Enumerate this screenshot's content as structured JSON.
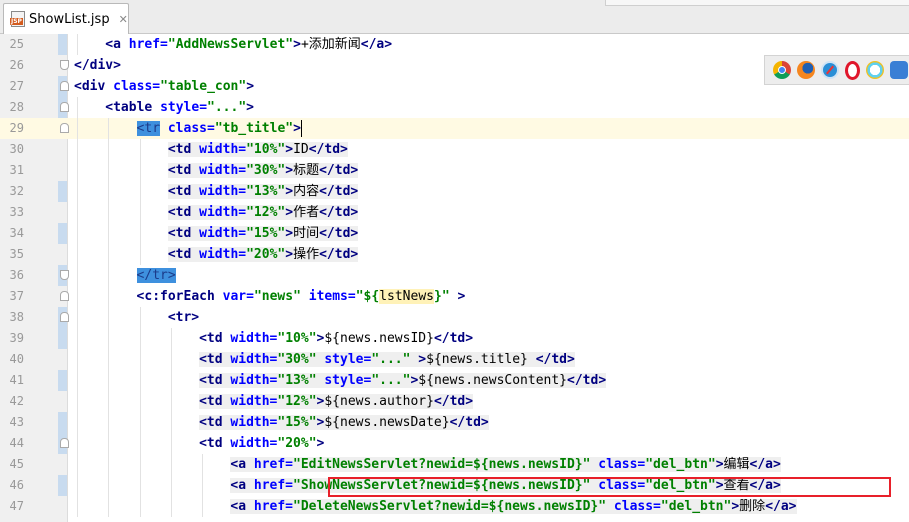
{
  "tab": {
    "title": "ShowList.jsp",
    "icon_text": "JSP"
  },
  "browser_toolbar": {
    "icons": [
      "chrome-icon",
      "firefox-icon",
      "safari-icon",
      "opera-icon",
      "ie-icon",
      "edge-icon"
    ]
  },
  "colors": {
    "tag": "#000080",
    "attribute": "#0000ff",
    "string": "#008000",
    "selection": "#3e90de",
    "caret_line": "#fffae3",
    "red_box": "#e8202a"
  },
  "editor": {
    "caret_line": "29",
    "lines": [
      {
        "num": "25",
        "tokens": [
          [
            "tag",
            "<a "
          ],
          [
            "attr",
            "href="
          ],
          [
            "str",
            "\"AddNewsServlet\""
          ],
          [
            "tag",
            ">"
          ],
          [
            "txt",
            "+添加新闻"
          ],
          [
            "tag",
            "</a>"
          ]
        ]
      },
      {
        "num": "26",
        "tokens": [
          [
            "tag",
            "</div>"
          ]
        ]
      },
      {
        "num": "27",
        "tokens": [
          [
            "tag",
            "<div "
          ],
          [
            "attr",
            "class="
          ],
          [
            "str",
            "\"table_con\""
          ],
          [
            "tag",
            ">"
          ]
        ]
      },
      {
        "num": "28",
        "tokens": [
          [
            "tag",
            "<table "
          ],
          [
            "attr",
            "style="
          ],
          [
            "str",
            "\"...\""
          ],
          [
            "tag",
            ">"
          ]
        ]
      },
      {
        "num": "29",
        "tokens": [
          [
            "sel",
            "<tr"
          ],
          [
            "tag",
            " "
          ],
          [
            "attr",
            "class="
          ],
          [
            "str",
            "\"tb_title\""
          ],
          [
            "tag",
            ">"
          ],
          [
            "cursor",
            ""
          ]
        ]
      },
      {
        "num": "30",
        "tokens": [
          [
            "tag",
            "<td "
          ],
          [
            "attr",
            "width="
          ],
          [
            "str",
            "\"10%\""
          ],
          [
            "tag",
            ">"
          ],
          [
            "txt",
            "ID"
          ],
          [
            "tag",
            "</td>"
          ]
        ]
      },
      {
        "num": "31",
        "tokens": [
          [
            "tag",
            "<td "
          ],
          [
            "attr",
            "width="
          ],
          [
            "str",
            "\"30%\""
          ],
          [
            "tag",
            ">"
          ],
          [
            "txt",
            "标题"
          ],
          [
            "tag",
            "</td>"
          ]
        ]
      },
      {
        "num": "32",
        "tokens": [
          [
            "tag",
            "<td "
          ],
          [
            "attr",
            "width="
          ],
          [
            "str",
            "\"13%\""
          ],
          [
            "tag",
            ">"
          ],
          [
            "txt",
            "内容"
          ],
          [
            "tag",
            "</td>"
          ]
        ]
      },
      {
        "num": "33",
        "tokens": [
          [
            "tag",
            "<td "
          ],
          [
            "attr",
            "width="
          ],
          [
            "str",
            "\"12%\""
          ],
          [
            "tag",
            ">"
          ],
          [
            "txt",
            "作者"
          ],
          [
            "tag",
            "</td>"
          ]
        ]
      },
      {
        "num": "34",
        "tokens": [
          [
            "tag",
            "<td "
          ],
          [
            "attr",
            "width="
          ],
          [
            "str",
            "\"15%\""
          ],
          [
            "tag",
            ">"
          ],
          [
            "txt",
            "时间"
          ],
          [
            "tag",
            "</td>"
          ]
        ]
      },
      {
        "num": "35",
        "tokens": [
          [
            "tag",
            "<td "
          ],
          [
            "attr",
            "width="
          ],
          [
            "str",
            "\"20%\""
          ],
          [
            "tag",
            ">"
          ],
          [
            "txt",
            "操作"
          ],
          [
            "tag",
            "</td>"
          ]
        ]
      },
      {
        "num": "36",
        "tokens": [
          [
            "sel",
            "</tr>"
          ]
        ]
      },
      {
        "num": "37",
        "tokens": [
          [
            "tag",
            "<c:forEach "
          ],
          [
            "attr",
            "var="
          ],
          [
            "str",
            "\"news\""
          ],
          [
            "tag",
            " "
          ],
          [
            "attr",
            "items="
          ],
          [
            "str",
            "\"${"
          ],
          [
            "hl",
            "lstNews"
          ],
          [
            "str",
            "}\""
          ],
          [
            "tag",
            " >"
          ]
        ]
      },
      {
        "num": "38",
        "tokens": [
          [
            "tag",
            "<tr>"
          ]
        ]
      },
      {
        "num": "39",
        "tokens": [
          [
            "tag",
            "<td "
          ],
          [
            "attr",
            "width="
          ],
          [
            "str",
            "\"10%\""
          ],
          [
            "tag",
            ">"
          ],
          [
            "el",
            "${news.newsID}"
          ],
          [
            "tag",
            "</td>"
          ]
        ]
      },
      {
        "num": "40",
        "tokens": [
          [
            "tag",
            "<td "
          ],
          [
            "attr",
            "width="
          ],
          [
            "str",
            "\"30%\""
          ],
          [
            "tag",
            " "
          ],
          [
            "attr",
            "style="
          ],
          [
            "str",
            "\"...\""
          ],
          [
            "tag",
            " >"
          ],
          [
            "el",
            "${news.title} "
          ],
          [
            "tag",
            "</td>"
          ]
        ]
      },
      {
        "num": "41",
        "tokens": [
          [
            "tag",
            "<td "
          ],
          [
            "attr",
            "width="
          ],
          [
            "str",
            "\"13%\""
          ],
          [
            "tag",
            " "
          ],
          [
            "attr",
            "style="
          ],
          [
            "str",
            "\"...\""
          ],
          [
            "tag",
            ">"
          ],
          [
            "el",
            "${news.newsContent}"
          ],
          [
            "tag",
            "</td>"
          ]
        ]
      },
      {
        "num": "42",
        "tokens": [
          [
            "tag",
            "<td "
          ],
          [
            "attr",
            "width="
          ],
          [
            "str",
            "\"12%\""
          ],
          [
            "tag",
            ">"
          ],
          [
            "el",
            "${news.author}"
          ],
          [
            "tag",
            "</td>"
          ]
        ]
      },
      {
        "num": "43",
        "tokens": [
          [
            "tag",
            "<td "
          ],
          [
            "attr",
            "width="
          ],
          [
            "str",
            "\"15%\""
          ],
          [
            "tag",
            ">"
          ],
          [
            "el",
            "${news.newsDate}"
          ],
          [
            "tag",
            "</td>"
          ]
        ]
      },
      {
        "num": "44",
        "tokens": [
          [
            "tag",
            "<td "
          ],
          [
            "attr",
            "width="
          ],
          [
            "str",
            "\"20%\""
          ],
          [
            "tag",
            ">"
          ]
        ]
      },
      {
        "num": "45",
        "tokens": [
          [
            "tag",
            "<a "
          ],
          [
            "attr",
            "href="
          ],
          [
            "str",
            "\"EditNewsServlet?newid=${news.newsID}\""
          ],
          [
            "tag",
            " "
          ],
          [
            "attr",
            "class="
          ],
          [
            "str",
            "\"del_btn\""
          ],
          [
            "tag",
            ">"
          ],
          [
            "txt",
            "编辑"
          ],
          [
            "tag",
            "</a>"
          ]
        ]
      },
      {
        "num": "46",
        "tokens": [
          [
            "tag",
            "<a "
          ],
          [
            "attr",
            "href="
          ],
          [
            "str",
            "\"ShowNewsServlet?newid=${news.newsID}\""
          ],
          [
            "tag",
            " "
          ],
          [
            "attr",
            "class="
          ],
          [
            "str",
            "\"del_btn\""
          ],
          [
            "tag",
            ">"
          ],
          [
            "txt",
            "查看"
          ],
          [
            "tag",
            "</a>"
          ]
        ]
      },
      {
        "num": "47",
        "tokens": [
          [
            "tag",
            "<a "
          ],
          [
            "attr",
            "href="
          ],
          [
            "str",
            "\"DeleteNewsServlet?newid=${news.newsID}\""
          ],
          [
            "tag",
            " "
          ],
          [
            "attr",
            "class="
          ],
          [
            "str",
            "\"del_btn\""
          ],
          [
            "tag",
            ">"
          ],
          [
            "txt",
            "删除"
          ],
          [
            "tag",
            "</a>"
          ]
        ]
      }
    ]
  }
}
